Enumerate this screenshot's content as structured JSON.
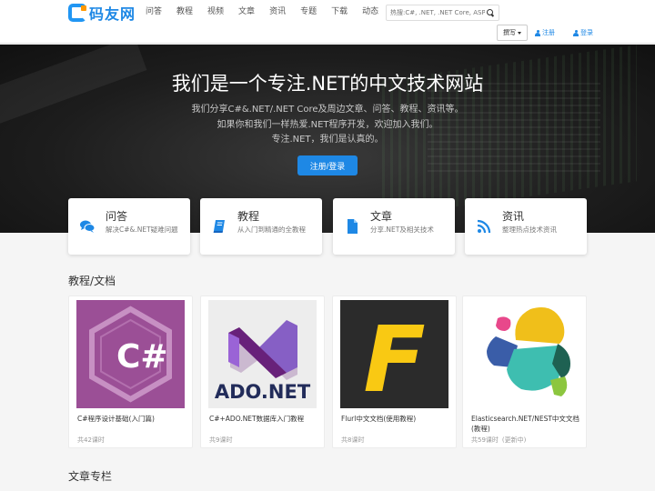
{
  "header": {
    "logo_text": "码友网",
    "nav": [
      "问答",
      "教程",
      "视频",
      "文章",
      "资讯",
      "专题",
      "下载",
      "动态"
    ],
    "search_placeholder": "热搜:C#, .NET, .NET Core, ASP.NET",
    "write_label": "撰写",
    "register_label": "注册",
    "login_label": "登录"
  },
  "hero": {
    "title": "我们是一个专注.NET的中文技术网站",
    "lines": [
      "我们分享C#&.NET/.NET Core及周边文章、问答、教程、资讯等。",
      "如果你和我们一样热爱.NET程序开发，欢迎加入我们。",
      "专注.NET，我们是认真的。"
    ],
    "button_label": "注册/登录"
  },
  "features": [
    {
      "title": "问答",
      "desc": "解决C#&.NET疑难问题",
      "icon": "chat-icon"
    },
    {
      "title": "教程",
      "desc": "从入门到精通的全教程",
      "icon": "book-icon"
    },
    {
      "title": "文章",
      "desc": "分享.NET及相关技术",
      "icon": "document-icon"
    },
    {
      "title": "资讯",
      "desc": "整理热点技术资讯",
      "icon": "rss-icon"
    }
  ],
  "sections": {
    "tutorials": "教程/文档",
    "articles": "文章专栏"
  },
  "courses": [
    {
      "name": "C#程序设计基础(入门篇)",
      "meta": "共42课时",
      "update": ""
    },
    {
      "name": "C#+ADO.NET数据库入门教程",
      "meta": "共9课时",
      "update": ""
    },
    {
      "name": "Flurl中文文档(使用教程)",
      "meta": "共8课时",
      "update": ""
    },
    {
      "name": "Elasticsearch.NET/NEST中文文档(教程)",
      "meta": "共59课时",
      "update": "(更新中)"
    }
  ],
  "course_logos": {
    "csharp": "C#",
    "adonet": "ADO.NET",
    "flurl": "F"
  },
  "colors": {
    "brand": "#1e88e5",
    "csharp_purple": "#9b4f96",
    "flurl_yellow": "#f9c913"
  }
}
